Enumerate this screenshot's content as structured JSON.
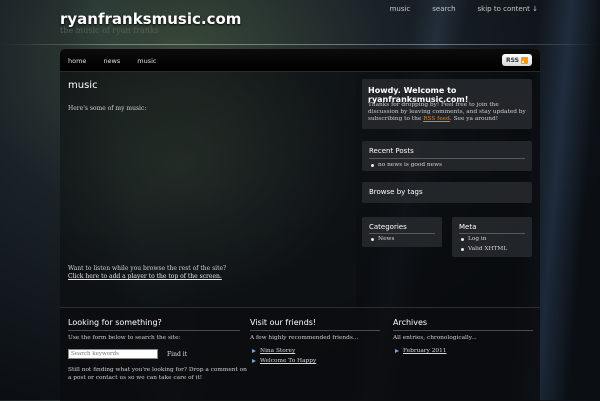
{
  "header": {
    "site_title": "ryanfranksmusic.com",
    "tagline": "the music of ryan franks",
    "top_links": [
      "music",
      "search",
      "skip to content ↓"
    ]
  },
  "nav": {
    "items": [
      "home",
      "news",
      "music"
    ],
    "rss_label": "RSS"
  },
  "content": {
    "title": "music",
    "intro": "Here's some of my music:",
    "player_prompt": "Want to listen while you browse the rest of the site?",
    "player_link": "Click here to add a player to the top of the screen."
  },
  "sidebar": {
    "welcome": {
      "title": "Howdy. Welcome to ryanfranksmusic.com!",
      "text_before": "Thanks for dropping by! Feel free to join the discussion by leaving comments, and stay updated by subscribing to the ",
      "link": "RSS feed",
      "text_after": ". See ya around!"
    },
    "recent_posts": {
      "title": "Recent Posts",
      "items": [
        "no news is good news"
      ]
    },
    "browse_tags": {
      "title": "Browse by tags"
    },
    "categories": {
      "title": "Categories",
      "items": [
        "News"
      ]
    },
    "meta": {
      "title": "Meta",
      "items": [
        "Log in",
        "Valid XHTML"
      ]
    }
  },
  "footer": {
    "search": {
      "title": "Looking for something?",
      "text": "Use the form below to search the site:",
      "placeholder": "Search keywords",
      "button": "Find it",
      "note": "Still not finding what you're looking for? Drop a comment on a post or contact us so we can take care of it!"
    },
    "friends": {
      "title": "Visit our friends!",
      "text": "A few highly recommended friends...",
      "links": [
        "Nina Storey",
        "Welcome To Happy"
      ]
    },
    "archives": {
      "title": "Archives",
      "text": "All entries, chronologically...",
      "links": [
        "February 2011"
      ]
    }
  },
  "colors": {
    "accent_link": "#e07f1f",
    "bullet_arrow": "#7aa4d8",
    "rss_icon": "#f39a1d"
  }
}
